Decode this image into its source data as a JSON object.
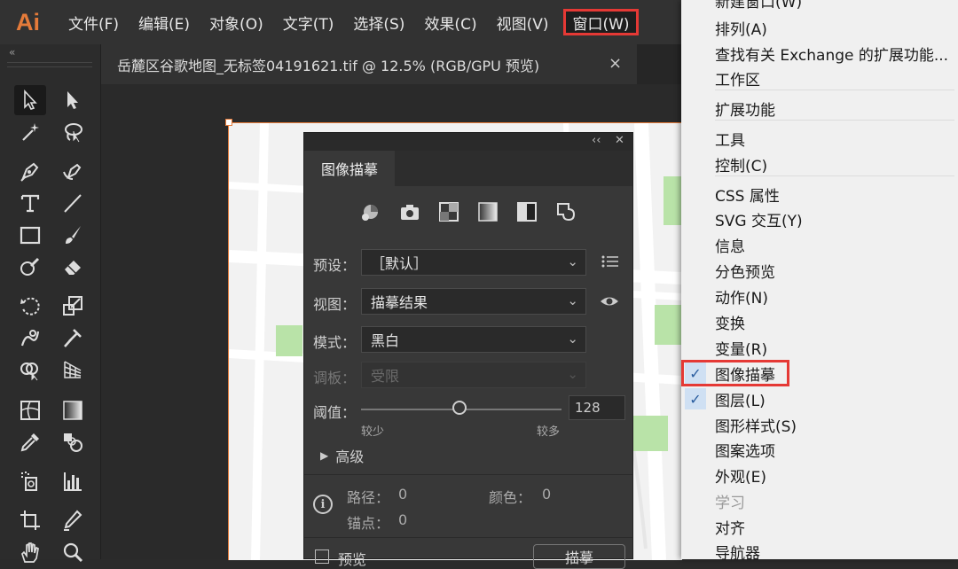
{
  "app": {
    "logo": "Ai"
  },
  "menubar": {
    "items": [
      "文件(F)",
      "编辑(E)",
      "对象(O)",
      "文字(T)",
      "选择(S)",
      "效果(C)",
      "视图(V)",
      "窗口(W)"
    ]
  },
  "toolbar": {
    "collapse": "«",
    "tools": [
      "selection-tool-icon",
      "direct-selection-tool-icon",
      "magic-wand-tool-icon",
      "lasso-tool-icon",
      "pen-tool-icon",
      "curvature-tool-icon",
      "type-tool-icon",
      "line-tool-icon",
      "rectangle-tool-icon",
      "paintbrush-tool-icon",
      "shaper-tool-icon",
      "eraser-tool-icon",
      "rotate-tool-icon",
      "scale-tool-icon",
      "warp-tool-icon",
      "puppet-warp-tool-icon",
      "shape-builder-tool-icon",
      "perspective-grid-tool-icon",
      "mesh-tool-icon",
      "gradient-tool-icon",
      "eyedropper-tool-icon",
      "blend-tool-icon",
      "symbol-sprayer-tool-icon",
      "column-graph-tool-icon",
      "artboard-tool-icon",
      "slice-tool-icon",
      "hand-tool-icon",
      "zoom-tool-icon"
    ]
  },
  "document": {
    "tab_title": "岳麓区谷歌地图_无标签04191621.tif @ 12.5% (RGB/GPU 预览)",
    "close": "×"
  },
  "trace_panel": {
    "tab": "图像描摹",
    "top_controls": [
      "‹‹",
      "✕"
    ],
    "preset_label": "预设：",
    "preset_value": "［默认］",
    "view_label": "视图：",
    "view_value": "描摹结果",
    "mode_label": "模式：",
    "mode_value": "黑白",
    "palette_label": "调板：",
    "palette_value": "受限",
    "threshold_label": "阈值：",
    "threshold_value": "128",
    "threshold_fraction": 0.49,
    "less_label": "较少",
    "more_label": "较多",
    "advanced_label": "高级",
    "paths_label": "路径：",
    "paths_value": "0",
    "colors_label": "颜色：",
    "colors_value": "0",
    "anchors_label": "锚点：",
    "anchors_value": "0",
    "preview_label": "预览",
    "trace_button": "描摹"
  },
  "window_menu": {
    "items": [
      {
        "label": "新建窗口(W)",
        "checked": false,
        "disabled": false
      },
      {
        "label": "排列(A)",
        "checked": false,
        "disabled": false
      },
      {
        "label": "查找有关 Exchange 的扩展功能...",
        "checked": false,
        "disabled": false
      },
      {
        "label": "工作区",
        "checked": false,
        "disabled": false
      },
      {
        "label": "扩展功能",
        "checked": false,
        "disabled": false
      },
      {
        "label": "工具",
        "checked": false,
        "disabled": false
      },
      {
        "label": "控制(C)",
        "checked": false,
        "disabled": false
      },
      {
        "label": "CSS 属性",
        "checked": false,
        "disabled": false
      },
      {
        "label": "SVG 交互(Y)",
        "checked": false,
        "disabled": false
      },
      {
        "label": "信息",
        "checked": false,
        "disabled": false
      },
      {
        "label": "分色预览",
        "checked": false,
        "disabled": false
      },
      {
        "label": "动作(N)",
        "checked": false,
        "disabled": false
      },
      {
        "label": "变换",
        "checked": false,
        "disabled": false
      },
      {
        "label": "变量(R)",
        "checked": false,
        "disabled": false
      },
      {
        "label": "图像描摹",
        "checked": true,
        "disabled": false
      },
      {
        "label": "图层(L)",
        "checked": true,
        "disabled": false
      },
      {
        "label": "图形样式(S)",
        "checked": false,
        "disabled": false
      },
      {
        "label": "图案选项",
        "checked": false,
        "disabled": false
      },
      {
        "label": "外观(E)",
        "checked": false,
        "disabled": false
      },
      {
        "label": "学习",
        "checked": false,
        "disabled": true
      },
      {
        "label": "对齐",
        "checked": false,
        "disabled": false
      },
      {
        "label": "导航器",
        "checked": false,
        "disabled": false
      }
    ]
  },
  "colors": {
    "accent_orange": "#e57b3a",
    "highlight_red": "#e53935",
    "map_green": "#b9e3a8"
  }
}
